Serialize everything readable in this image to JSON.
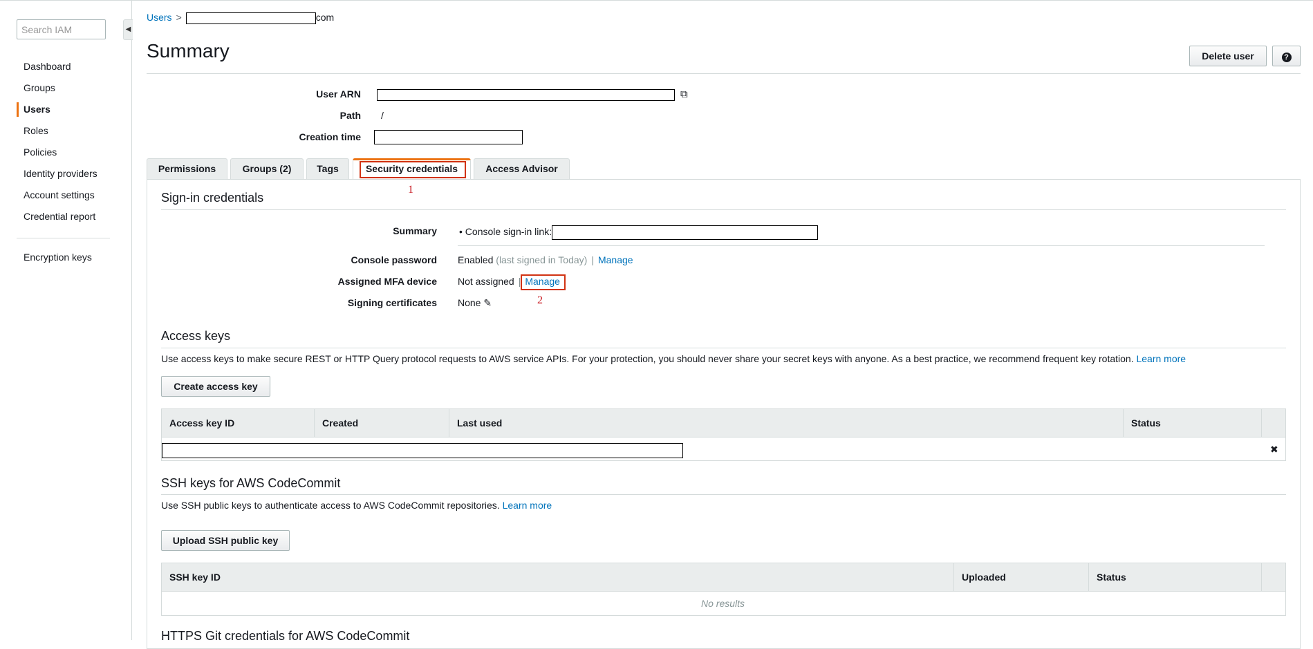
{
  "sidebar": {
    "search_placeholder": "Search IAM",
    "items": [
      {
        "label": "Dashboard",
        "active": false
      },
      {
        "label": "Groups",
        "active": false
      },
      {
        "label": "Users",
        "active": true
      },
      {
        "label": "Roles",
        "active": false
      },
      {
        "label": "Policies",
        "active": false
      },
      {
        "label": "Identity providers",
        "active": false
      },
      {
        "label": "Account settings",
        "active": false
      },
      {
        "label": "Credential report",
        "active": false
      }
    ],
    "secondary_item": "Encryption keys"
  },
  "breadcrumb": {
    "root": "Users",
    "separator": ">",
    "suffix": "com"
  },
  "header": {
    "title": "Summary",
    "delete_label": "Delete user",
    "help_label": "?"
  },
  "user": {
    "arn_label": "User ARN",
    "path_label": "Path",
    "path_value": "/",
    "creation_label": "Creation time"
  },
  "tabs": [
    {
      "label": "Permissions"
    },
    {
      "label": "Groups (2)"
    },
    {
      "label": "Tags"
    },
    {
      "label": "Security credentials",
      "active": true
    },
    {
      "label": "Access Advisor"
    }
  ],
  "annotations": {
    "one": "1",
    "two": "2"
  },
  "signin": {
    "title": "Sign-in credentials",
    "summary_label": "Summary",
    "console_link_label": "Console sign-in link:",
    "password_label": "Console password",
    "password_status": "Enabled",
    "password_note": "(last signed in Today)",
    "password_manage": "Manage",
    "mfa_label": "Assigned MFA device",
    "mfa_status": "Not assigned",
    "mfa_manage": "Manage",
    "certs_label": "Signing certificates",
    "certs_value": "None",
    "pipe": "|"
  },
  "access_keys": {
    "title": "Access keys",
    "description": "Use access keys to make secure REST or HTTP Query protocol requests to AWS service APIs. For your protection, you should never share your secret keys with anyone. As a best practice, we recommend frequent key rotation.",
    "learn_more": "Learn more",
    "create_label": "Create access key",
    "columns": [
      "Access key ID",
      "Created",
      "Last used",
      "Status"
    ],
    "delete_glyph": "✖"
  },
  "ssh": {
    "title": "SSH keys for AWS CodeCommit",
    "description": "Use SSH public keys to authenticate access to AWS CodeCommit repositories.",
    "learn_more": "Learn more",
    "upload_label": "Upload SSH public key",
    "columns": [
      "SSH key ID",
      "Uploaded",
      "Status"
    ],
    "no_results": "No results"
  },
  "https": {
    "title": "HTTPS Git credentials for AWS CodeCommit"
  },
  "colors": {
    "accent": "#ec7211",
    "link": "#0073bb",
    "annotation": "#c7161e"
  }
}
